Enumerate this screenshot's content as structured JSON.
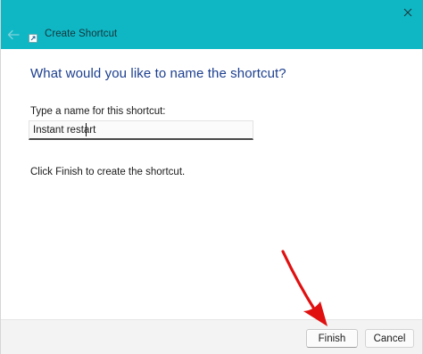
{
  "window": {
    "title": "Create Shortcut",
    "accent_color": "#0fb7c5"
  },
  "titlebar": {
    "close_icon": "close-icon",
    "back_icon": "back-arrow-icon",
    "app_icon": "shortcut-icon"
  },
  "wizard": {
    "heading": "What would you like to name the shortcut?",
    "field_label": "Type a name for this shortcut:",
    "name_value": "Instant restart",
    "instruction": "Click Finish to create the shortcut."
  },
  "footer": {
    "finish_label": "Finish",
    "cancel_label": "Cancel"
  },
  "annotation": {
    "type": "red-pointer-arrow",
    "color": "#e01010"
  }
}
